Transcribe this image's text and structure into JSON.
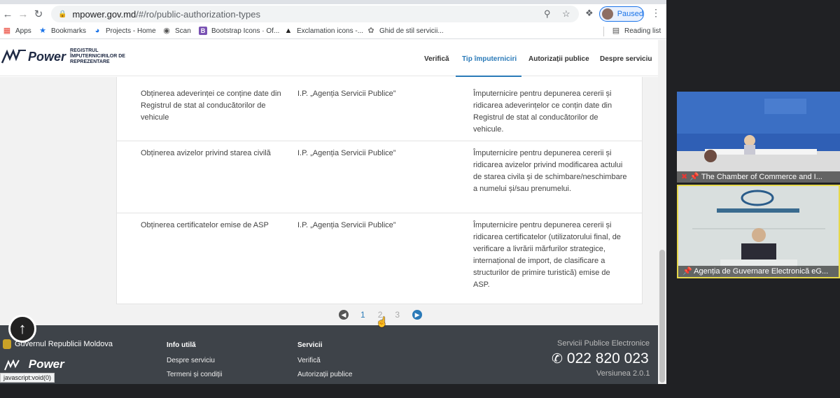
{
  "browser": {
    "url_host": "mpower.gov.md",
    "url_path": "/#/ro/public-authorization-types",
    "profile_status": "Paused",
    "bookmarks": [
      {
        "label": "Apps",
        "icon": "apps-grid-icon"
      },
      {
        "label": "Bookmarks",
        "icon": "star-icon"
      },
      {
        "label": "Projects - Home",
        "icon": "project-icon"
      },
      {
        "label": "Scan",
        "icon": "globe-icon"
      },
      {
        "label": "Bootstrap Icons · Of...",
        "icon": "bootstrap-icon"
      },
      {
        "label": "Exclamation icons -...",
        "icon": "exclamation-icon"
      },
      {
        "label": "Ghid de stil servicii...",
        "icon": "style-guide-icon"
      }
    ],
    "reading_list": "Reading list",
    "status_bar": "javascript:void(0)"
  },
  "site": {
    "logo_word": "Power",
    "logo_sub_1": "REGISTRUL",
    "logo_sub_2": "ÎMPUTERNICIRILOR DE",
    "logo_sub_3": "REPREZENTARE",
    "nav": [
      "Verifică",
      "Tip împuterniciri",
      "Autorizații publice",
      "Despre serviciu"
    ],
    "active_nav": "Tip împuterniciri",
    "accent_color": "#2a7ab8"
  },
  "table": {
    "rows": [
      {
        "service": "Obținerea adeverinței ce conține date din Registrul de stat al conducătorilor de vehicule",
        "authority": "I.P. „Agenția Servicii Publice”",
        "description": "Împuternicire pentru depunerea cererii și ridicarea adeverințelor ce conțin date din Registrul de stat al conducătorilor de vehicule."
      },
      {
        "service": "Obținerea avizelor privind starea civilă",
        "authority": "I.P. „Agenția Servicii Publice”",
        "description": "Împuternicire pentru depunerea cererii și ridicarea avizelor privind modificarea actului de starea civila și de schimbare/neschimbare a numelui și/sau prenumelui."
      },
      {
        "service": "Obținerea certificatelor emise de ASP",
        "authority": "I.P. „Agenția Servicii Publice”",
        "description": "Împuternicire pentru depunerea cererii și ridicarea certificatelor (utilizatorului final, de verificare a livrării mărfurilor strategice, internațional de import, de clasificare a structurilor de primire turistică) emise de ASP."
      }
    ]
  },
  "pagination": {
    "pages": [
      "1",
      "2",
      "3"
    ],
    "current_page": "2"
  },
  "footer": {
    "gov_name": "Guvernul Republicii Moldova",
    "logo_word": "Power",
    "info_heading": "Info utilă",
    "info_links": [
      "Despre serviciu",
      "Termeni și condiții"
    ],
    "services_heading": "Servicii",
    "services_links": [
      "Verifică",
      "Autorizații publice"
    ],
    "eservices_label": "Servicii Publice Electronice",
    "phone": "022 820 023",
    "version": "Versiunea 2.0.1"
  },
  "video_call": {
    "tiles": [
      {
        "label": "The Chamber of Commerce and I..."
      },
      {
        "label": "Agenția de Guvernare Electronică eG..."
      }
    ]
  }
}
